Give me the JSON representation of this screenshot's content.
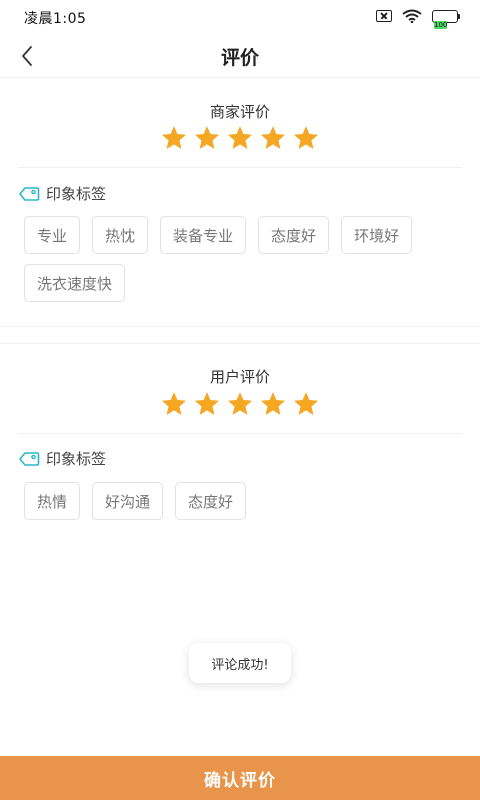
{
  "status_bar": {
    "time": "凌晨1:05",
    "battery_level": "100",
    "icons": [
      "sim-off-icon",
      "wifi-icon",
      "battery-icon"
    ]
  },
  "nav": {
    "title": "评价",
    "back_icon": "chevron-left-icon"
  },
  "merchant_review": {
    "title": "商家评价",
    "rating": 5,
    "max_rating": 5,
    "impression_label": "印象标签",
    "tags": [
      "专业",
      "热忱",
      "装备专业",
      "态度好",
      "环境好",
      "洗衣速度快"
    ]
  },
  "user_review": {
    "title": "用户评价",
    "rating": 5,
    "max_rating": 5,
    "impression_label": "印象标签",
    "tags": [
      "热情",
      "好沟通",
      "态度好"
    ]
  },
  "toast": {
    "message": "评论成功!"
  },
  "footer": {
    "confirm_label": "确认评价"
  },
  "colors": {
    "accent": "#e8944a",
    "star": "#f5a623",
    "tag_icon": "#2bb5c8",
    "tag_border": "#e2e2e2"
  }
}
